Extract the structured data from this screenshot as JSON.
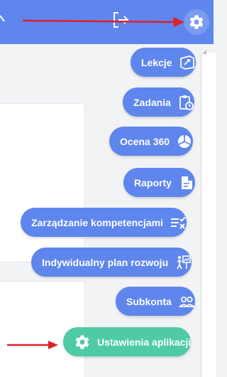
{
  "menu": {
    "items": [
      {
        "label": "Lekcje",
        "icon": "lesson-icon"
      },
      {
        "label": "Zadania",
        "icon": "clipboard-clock-icon"
      },
      {
        "label": "Ocena 360",
        "icon": "pie-chart-icon"
      },
      {
        "label": "Raporty",
        "icon": "report-document-icon"
      },
      {
        "label": "Zarządzanie kompetencjami",
        "icon": "checklist-icon"
      },
      {
        "label": "Indywidualny plan rozwoju",
        "icon": "development-plan-icon"
      },
      {
        "label": "Subkonta",
        "icon": "users-icon"
      },
      {
        "label": "Ustawienia aplikacji",
        "icon": "gear-icon"
      }
    ]
  },
  "colors": {
    "primary": "#5e86ec",
    "highlight": "#4ecba5",
    "annotation_arrow": "#e0202a",
    "background": "#f2f3f5"
  }
}
